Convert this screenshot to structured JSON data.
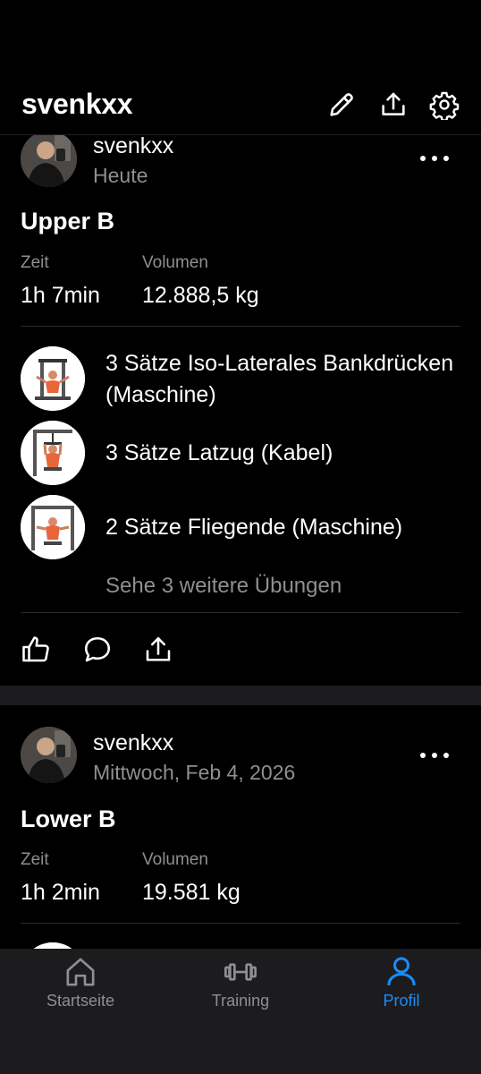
{
  "header": {
    "title": "svenkxx"
  },
  "posts": [
    {
      "username": "svenkxx",
      "date": "Heute",
      "workout_title": "Upper B",
      "time_label": "Zeit",
      "time_value": "1h 7min",
      "volume_label": "Volumen",
      "volume_value": "12.888,5 kg",
      "exercises": [
        {
          "text": "3 Sätze Iso-Laterales Bankdrücken (Maschine)"
        },
        {
          "text": "3 Sätze Latzug (Kabel)"
        },
        {
          "text": "2 Sätze Fliegende (Maschine)"
        }
      ],
      "see_more": "Sehe 3 weitere Übungen"
    },
    {
      "username": "svenkxx",
      "date": "Mittwoch, Feb 4, 2026",
      "workout_title": "Lower B",
      "time_label": "Zeit",
      "time_value": "1h 2min",
      "volume_label": "Volumen",
      "volume_value": "19.581 kg"
    }
  ],
  "tabbar": {
    "items": [
      {
        "label": "Startseite",
        "icon": "home-icon",
        "active": false
      },
      {
        "label": "Training",
        "icon": "dumbbell-icon",
        "active": false
      },
      {
        "label": "Profil",
        "icon": "person-icon",
        "active": true
      }
    ],
    "active_color": "#1a8cff",
    "inactive_color": "#8e8e93"
  }
}
